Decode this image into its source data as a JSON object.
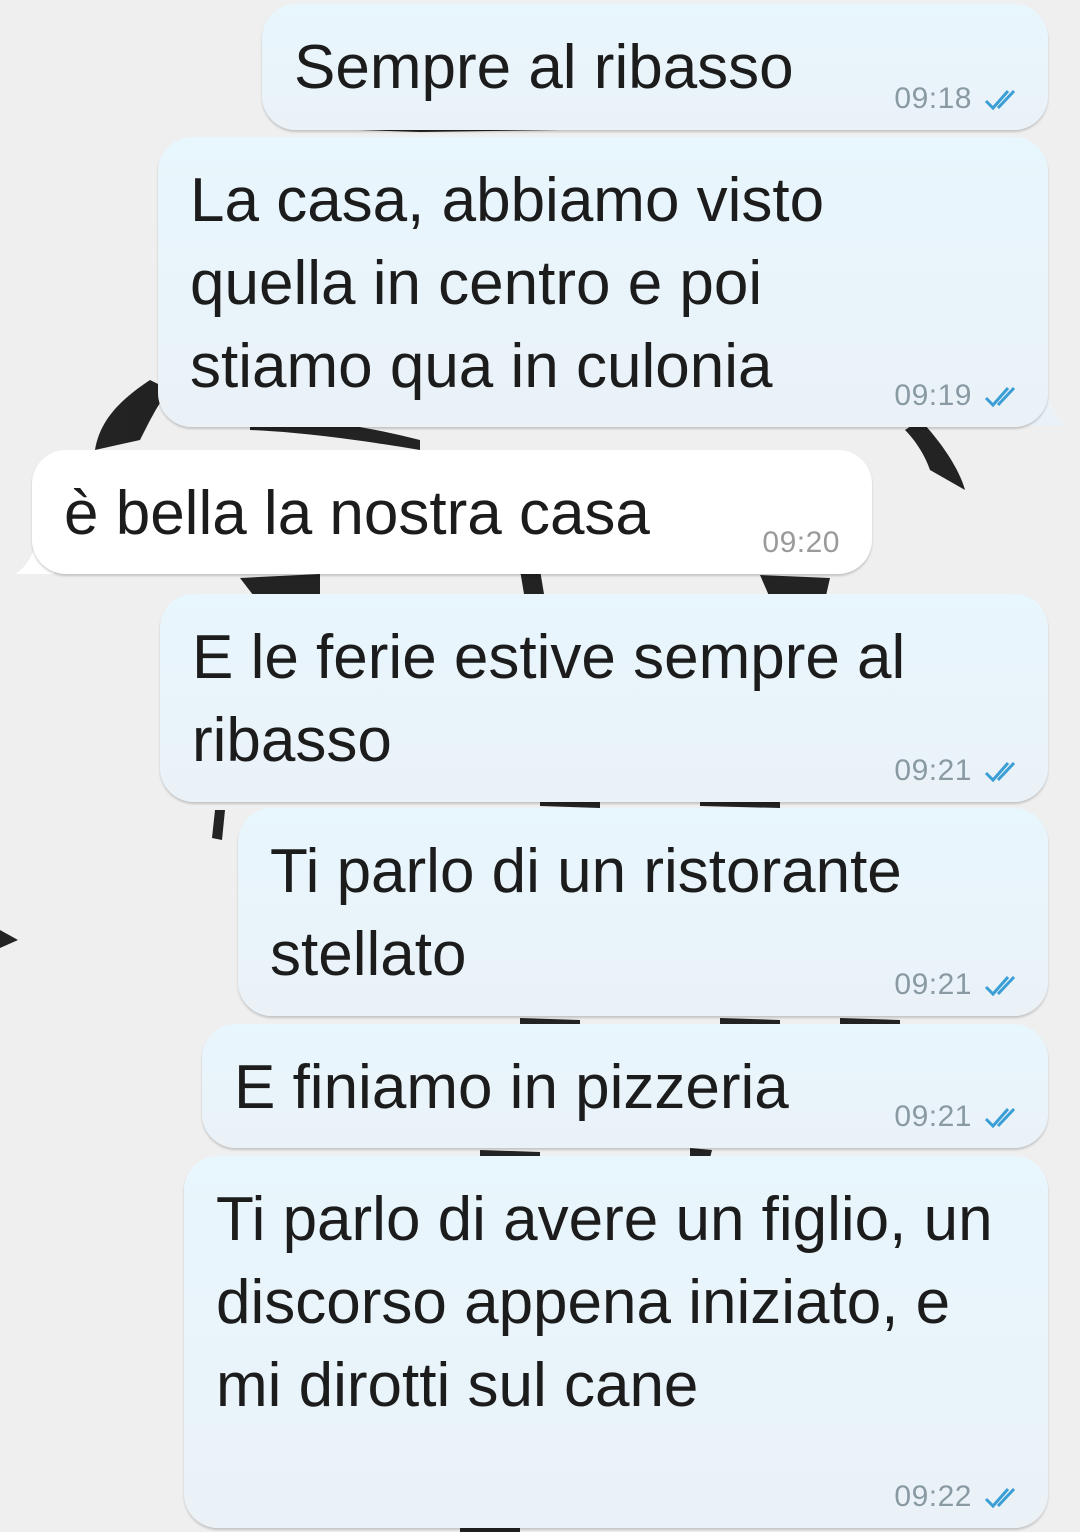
{
  "colors": {
    "outgoing_bubble": "#e8f6fd",
    "incoming_bubble": "#ffffff",
    "read_check": "#3b9fd6",
    "wallpaper": "#efefef"
  },
  "messages": [
    {
      "direction": "outgoing",
      "text": "Sempre al ribasso",
      "time": "09:18",
      "status_icon": "double-check-icon"
    },
    {
      "direction": "outgoing",
      "text": "La casa, abbiamo visto quella in centro e poi stiamo qua in culonia",
      "time": "09:19",
      "status_icon": "double-check-icon"
    },
    {
      "direction": "incoming",
      "text": "è bella la nostra casa",
      "time": "09:20"
    },
    {
      "direction": "outgoing",
      "text": "E le ferie estive sempre al ribasso",
      "time": "09:21",
      "status_icon": "double-check-icon"
    },
    {
      "direction": "outgoing",
      "text": "Ti parlo di un ristorante stellato",
      "time": "09:21",
      "status_icon": "double-check-icon"
    },
    {
      "direction": "outgoing",
      "text": "E finiamo in pizzeria",
      "time": "09:21",
      "status_icon": "double-check-icon"
    },
    {
      "direction": "outgoing",
      "text": "Ti parlo di avere un figlio, un discorso appena iniziato, e mi dirotti sul cane",
      "time": "09:22",
      "status_icon": "double-check-icon"
    }
  ]
}
